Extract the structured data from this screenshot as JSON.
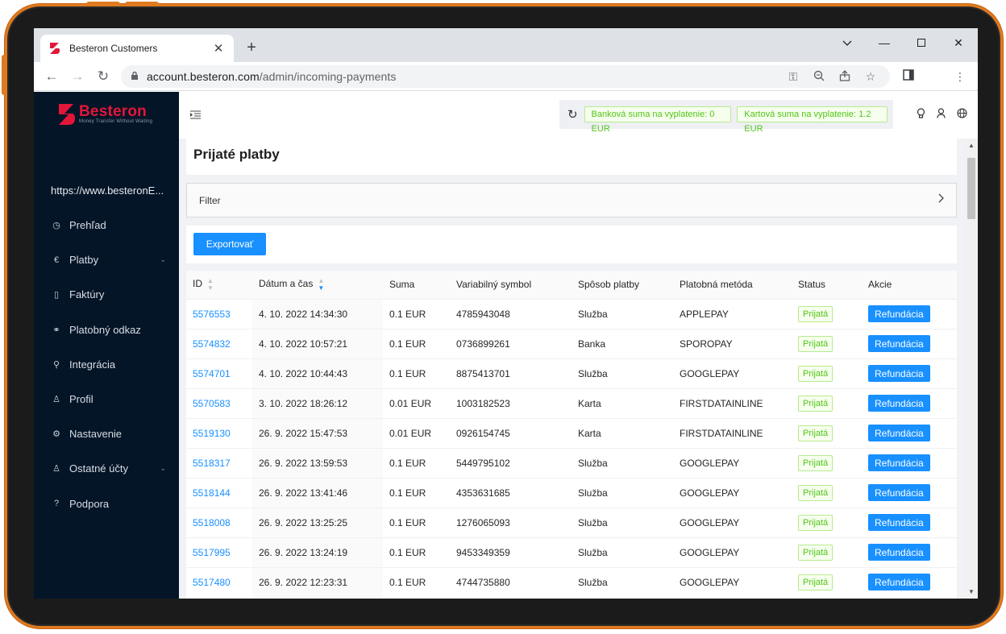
{
  "browser": {
    "tab_title": "Besteron Customers",
    "tab_favicon": "Ƨ",
    "url_host": "account.besteron.com",
    "url_path": "/admin/incoming-payments"
  },
  "sidebar": {
    "logo_name": "Besteron",
    "logo_tagline": "Money Transfer Without Waiting",
    "site_url": "https://www.besteronE...",
    "items": [
      {
        "label": "Prehľad",
        "icon": "dashboard-icon"
      },
      {
        "label": "Platby",
        "icon": "euro-icon",
        "expandable": true
      },
      {
        "label": "Faktúry",
        "icon": "file-icon"
      },
      {
        "label": "Platobný odkaz",
        "icon": "link-icon"
      },
      {
        "label": "Integrácia",
        "icon": "api-icon"
      },
      {
        "label": "Profil",
        "icon": "user-icon"
      },
      {
        "label": "Nastavenie",
        "icon": "settings-icon"
      },
      {
        "label": "Ostatné účty",
        "icon": "users-icon",
        "expandable": true
      },
      {
        "label": "Podpora",
        "icon": "question-icon"
      }
    ]
  },
  "topbar": {
    "bank_sum": "Banková suma na vyplatenie: 0 EUR",
    "card_sum": "Kartová suma na vyplatenie: 1.2 EUR"
  },
  "page": {
    "title": "Prijaté platby",
    "filter_label": "Filter",
    "export_label": "Exportovať"
  },
  "table": {
    "headers": [
      "ID",
      "Dátum a čas",
      "Suma",
      "Variabilný symbol",
      "Spôsob platby",
      "Platobná metóda",
      "Status",
      "Akcie"
    ],
    "rows": [
      {
        "id": "5576553",
        "datetime": "4. 10. 2022 14:34:30",
        "amount": "0.1 EUR",
        "vs": "4785943048",
        "way": "Služba",
        "method": "APPLEPAY",
        "status": "Prijatá",
        "action": "Refundácia"
      },
      {
        "id": "5574832",
        "datetime": "4. 10. 2022 10:57:21",
        "amount": "0.1 EUR",
        "vs": "0736899261",
        "way": "Banka",
        "method": "SPOROPAY",
        "status": "Prijatá",
        "action": "Refundácia"
      },
      {
        "id": "5574701",
        "datetime": "4. 10. 2022 10:44:43",
        "amount": "0.1 EUR",
        "vs": "8875413701",
        "way": "Služba",
        "method": "GOOGLEPAY",
        "status": "Prijatá",
        "action": "Refundácia"
      },
      {
        "id": "5570583",
        "datetime": "3. 10. 2022 18:26:12",
        "amount": "0.01 EUR",
        "vs": "1003182523",
        "way": "Karta",
        "method": "FIRSTDATAINLINE",
        "status": "Prijatá",
        "action": "Refundácia"
      },
      {
        "id": "5519130",
        "datetime": "26. 9. 2022 15:47:53",
        "amount": "0.01 EUR",
        "vs": "0926154745",
        "way": "Karta",
        "method": "FIRSTDATAINLINE",
        "status": "Prijatá",
        "action": "Refundácia"
      },
      {
        "id": "5518317",
        "datetime": "26. 9. 2022 13:59:53",
        "amount": "0.1 EUR",
        "vs": "5449795102",
        "way": "Služba",
        "method": "GOOGLEPAY",
        "status": "Prijatá",
        "action": "Refundácia"
      },
      {
        "id": "5518144",
        "datetime": "26. 9. 2022 13:41:46",
        "amount": "0.1 EUR",
        "vs": "4353631685",
        "way": "Služba",
        "method": "GOOGLEPAY",
        "status": "Prijatá",
        "action": "Refundácia"
      },
      {
        "id": "5518008",
        "datetime": "26. 9. 2022 13:25:25",
        "amount": "0.1 EUR",
        "vs": "1276065093",
        "way": "Služba",
        "method": "GOOGLEPAY",
        "status": "Prijatá",
        "action": "Refundácia"
      },
      {
        "id": "5517995",
        "datetime": "26. 9. 2022 13:24:19",
        "amount": "0.1 EUR",
        "vs": "9453349359",
        "way": "Služba",
        "method": "GOOGLEPAY",
        "status": "Prijatá",
        "action": "Refundácia"
      },
      {
        "id": "5517480",
        "datetime": "26. 9. 2022 12:23:31",
        "amount": "0.1 EUR",
        "vs": "4744735880",
        "way": "Služba",
        "method": "GOOGLEPAY",
        "status": "Prijatá",
        "action": "Refundácia"
      }
    ]
  },
  "colors": {
    "accent": "#1890ff",
    "brand": "#e3163a",
    "sidebar_bg": "#041527",
    "status_green": "#52c41a",
    "device_frame": "#e07a1f"
  }
}
